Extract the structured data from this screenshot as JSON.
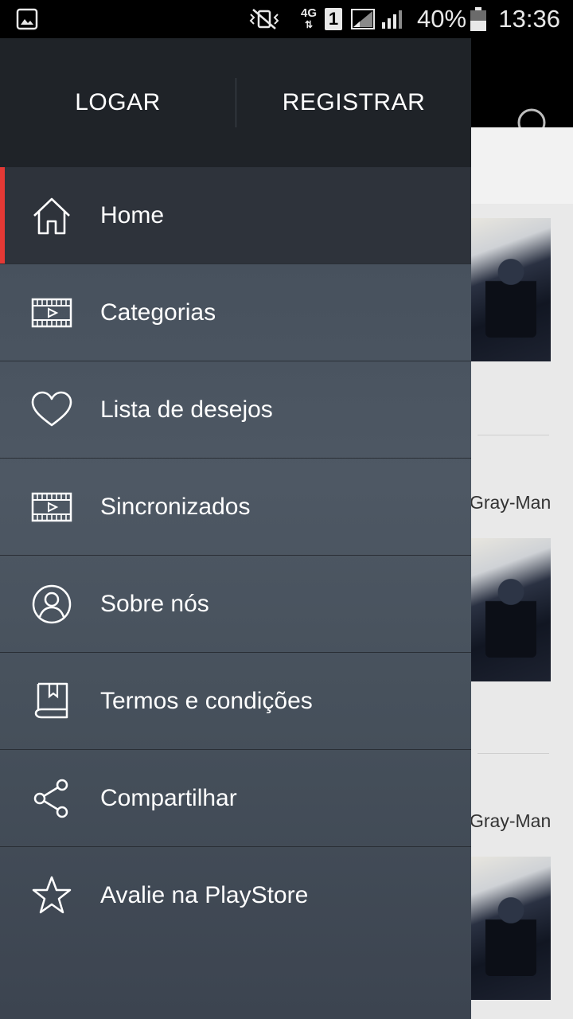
{
  "status_bar": {
    "battery": "40%",
    "time": "13:36",
    "network": "4G",
    "sim": "1"
  },
  "drawer": {
    "login_label": "LOGAR",
    "register_label": "REGISTRAR",
    "items": [
      {
        "label": "Home",
        "icon": "home-icon",
        "active": true
      },
      {
        "label": "Categorias",
        "icon": "film-icon"
      },
      {
        "label": "Lista de desejos",
        "icon": "heart-icon"
      },
      {
        "label": "Sincronizados",
        "icon": "film-icon"
      },
      {
        "label": "Sobre nós",
        "icon": "user-circle-icon"
      },
      {
        "label": "Termos e condições",
        "icon": "document-icon"
      },
      {
        "label": "Compartilhar",
        "icon": "share-icon"
      },
      {
        "label": "Avalie na PlayStore",
        "icon": "star-icon"
      }
    ]
  },
  "background": {
    "tab_fragment": "os",
    "caption_1": "Gray-Man",
    "caption_2": "Gray-Man"
  },
  "colors": {
    "accent": "#e53935",
    "header_bg": "#1f2328",
    "active_bg": "#2e333b"
  }
}
